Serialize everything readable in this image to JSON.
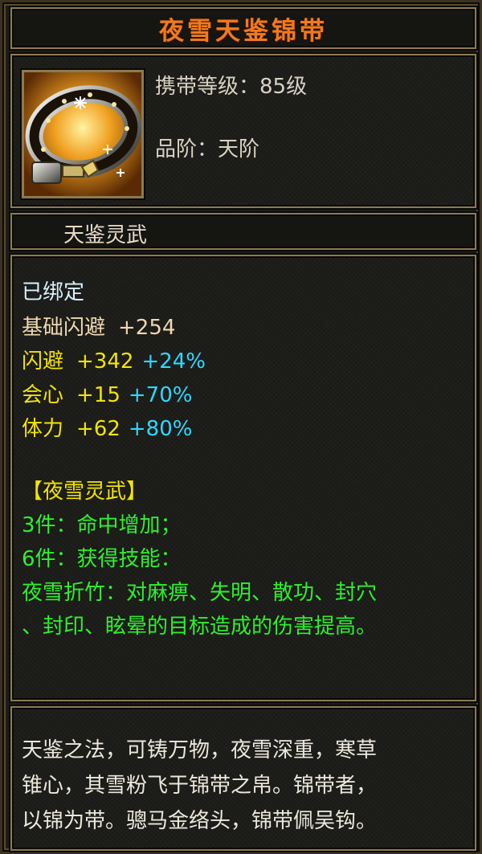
{
  "item": {
    "name": "夜雪天鉴锦带",
    "icon": "belt-icon",
    "carry_level_label": "携带等级：",
    "carry_level_value": "85级",
    "grade_label": "品阶：",
    "grade_value": "天阶",
    "set_series": "天鉴灵武"
  },
  "stats": {
    "bound_status": "已绑定",
    "base_label": "基础闪避",
    "base_value": "+254",
    "attributes": [
      {
        "label": "闪避",
        "value": "+342",
        "percent": "+24%"
      },
      {
        "label": "会心",
        "value": "+15",
        "percent": "+70%"
      },
      {
        "label": "体力",
        "value": "+62",
        "percent": "+80%"
      }
    ]
  },
  "set_bonus": {
    "title": "【夜雪灵武】",
    "piece3": "3件：命中增加；",
    "piece6": "6件：获得技能：",
    "skill_line1": "夜雪折竹：对麻痹、失明、散功、封穴",
    "skill_line2": "、封印、眩晕的目标造成的伤害提高。"
  },
  "flavor": {
    "line1": "天鉴之法，可铸万物，夜雪深重，寒草",
    "line2": "锥心，其雪粉飞于锦带之帛。锦带者，",
    "line3": "以锦为带。骢马金络头，锦带佩吴钩。"
  },
  "colors": {
    "title": "#f07a1e",
    "bound": "#d8f2ff",
    "base": "#eed8b0",
    "attribute": "#f2e400",
    "percent": "#2ed8ff",
    "set_bonus": "#2ef02e",
    "frame": "#8c7a52"
  }
}
